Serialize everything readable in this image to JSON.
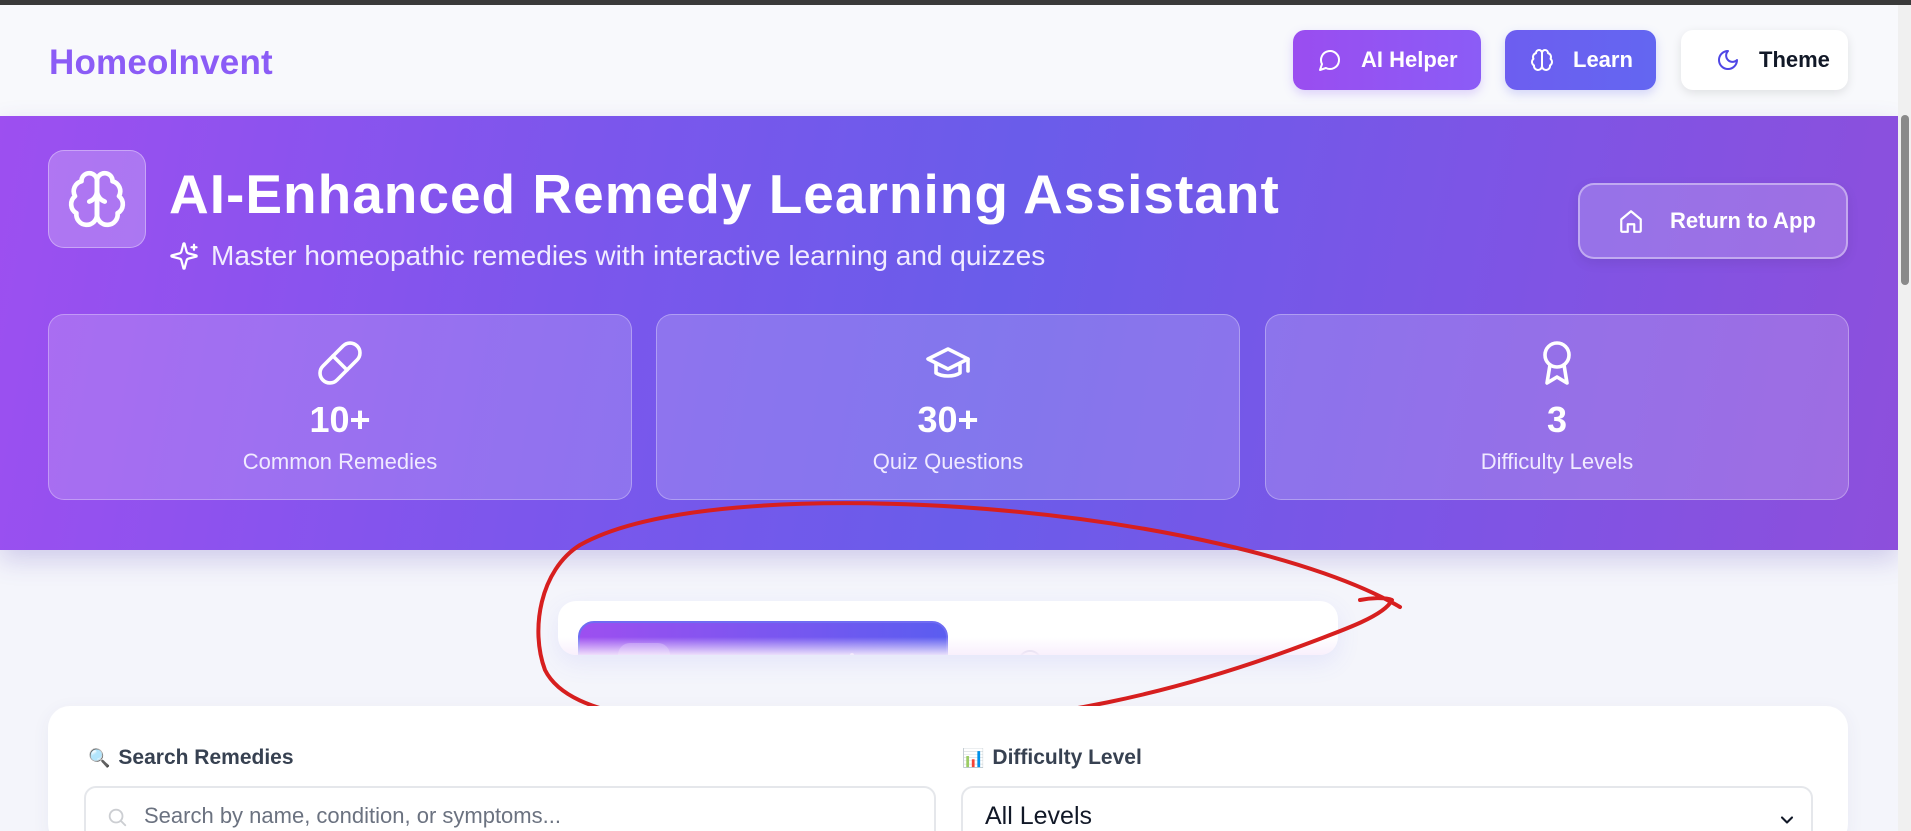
{
  "header": {
    "logo": "HomeoInvent",
    "buttons": {
      "ai_helper": "AI Helper",
      "learn": "Learn",
      "theme": "Theme"
    }
  },
  "hero": {
    "title": "AI-Enhanced Remedy Learning Assistant",
    "subtitle": "Master homeopathic remedies with interactive learning and quizzes",
    "return_button": "Return to App",
    "stats": [
      {
        "value": "10+",
        "label": "Common Remedies",
        "icon": "pill-icon"
      },
      {
        "value": "30+",
        "label": "Quiz Questions",
        "icon": "graduation-cap-icon"
      },
      {
        "value": "3",
        "label": "Difficulty Levels",
        "icon": "award-icon"
      }
    ]
  },
  "filters": {
    "search_label": "Search Remedies",
    "search_emoji": "🔍",
    "search_placeholder": "Search by name, condition, or symptoms...",
    "difficulty_label": "Difficulty Level",
    "difficulty_emoji": "📊",
    "difficulty_value": "All Levels"
  },
  "colors": {
    "brand_purple": "#8b5cf6",
    "indigo": "#6366f1",
    "annotation_red": "#d71f1f"
  }
}
